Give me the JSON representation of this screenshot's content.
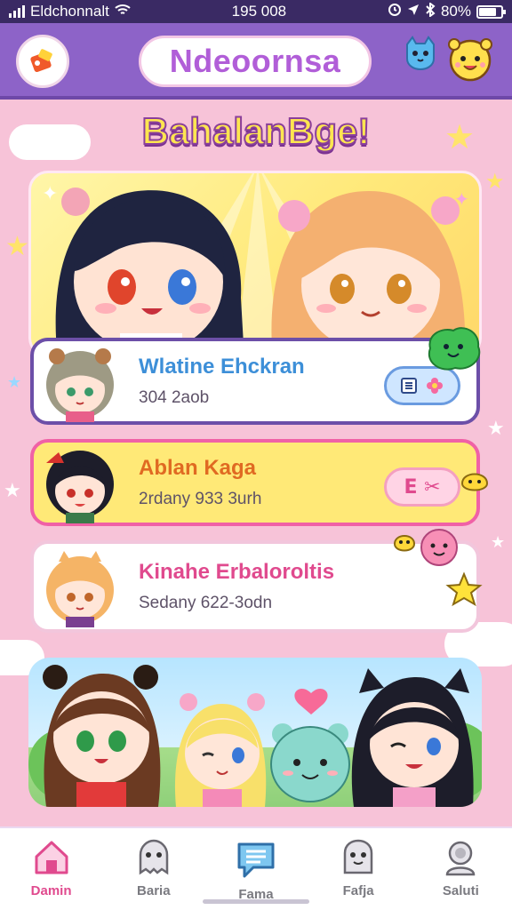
{
  "status_bar": {
    "carrier": "Eldchonnalt",
    "time": "195 008",
    "battery": "80%",
    "battery_level": 0.8
  },
  "header": {
    "title": "Ndeoornsa"
  },
  "banner": {
    "title": "BahalanBge!"
  },
  "cards": [
    {
      "name": "Wlatine Ehckran",
      "subtitle": "304 2aob"
    },
    {
      "name": "Ablan Kaga",
      "subtitle": "2rdany 933 3urh",
      "action_label": "E ✂"
    },
    {
      "name": "Kinahe Erbaloroltis",
      "subtitle": "Sedany 622-3odn"
    }
  ],
  "bottom_nav": [
    {
      "label": "Damin",
      "icon": "home-icon",
      "active": true
    },
    {
      "label": "Baria",
      "icon": "ghost-icon",
      "active": false
    },
    {
      "label": "Fama",
      "icon": "chat-icon",
      "active": false
    },
    {
      "label": "Fafja",
      "icon": "mascot-icon",
      "active": false
    },
    {
      "label": "Saluti",
      "icon": "profile-icon",
      "active": false
    }
  ],
  "colors": {
    "header": "#8d63c8",
    "accent_pink": "#e04a8e",
    "card_yellow": "#ffe977"
  }
}
